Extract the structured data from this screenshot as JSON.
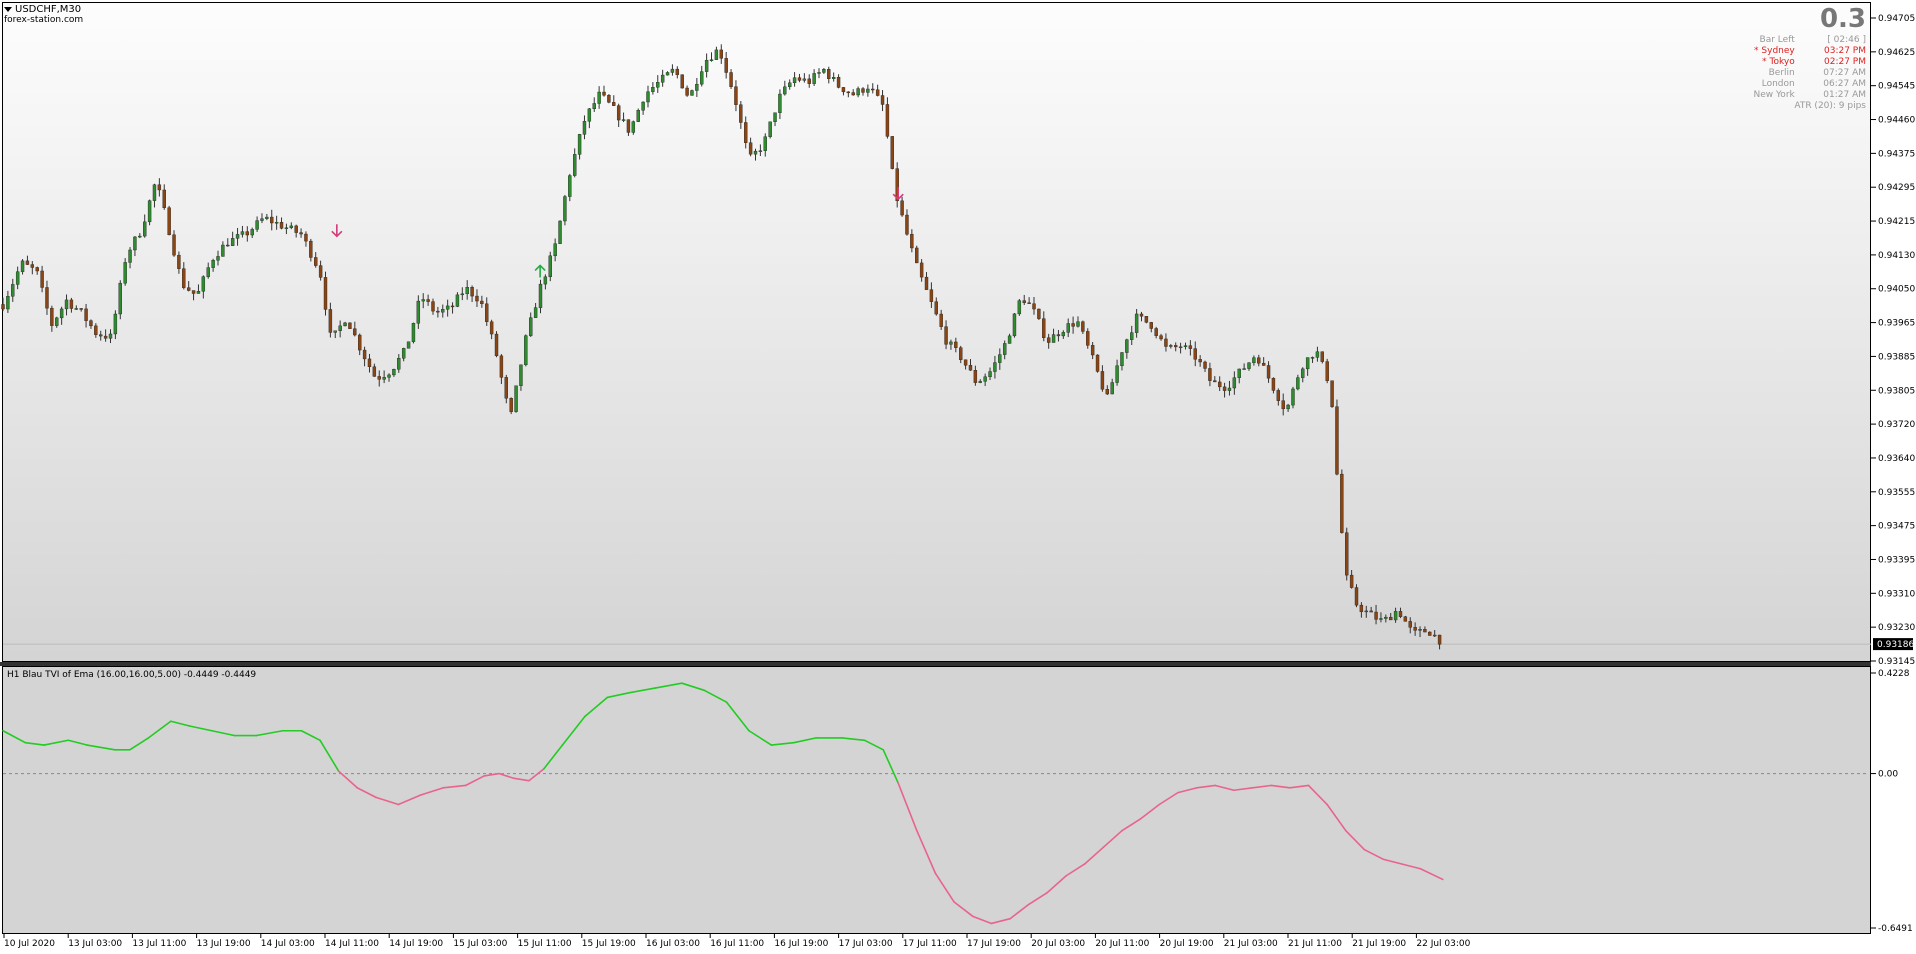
{
  "header": {
    "symbol": "USDCHF,M30",
    "site": "forex-station.com"
  },
  "info_panel": {
    "value": "0.3",
    "rows": [
      {
        "label": "Bar Left",
        "value": "[ 02:46 ]",
        "color": "#999999"
      },
      {
        "label": "* Sydney",
        "value": "03:27 PM",
        "color": "#e02020"
      },
      {
        "label": "* Tokyo",
        "value": "02:27 PM",
        "color": "#e02020"
      },
      {
        "label": "Berlin",
        "value": "07:27 AM",
        "color": "#999999"
      },
      {
        "label": "London",
        "value": "06:27 AM",
        "color": "#999999"
      },
      {
        "label": "New York",
        "value": "01:27 AM",
        "color": "#999999"
      }
    ],
    "atr": "ATR (20): 9 pips"
  },
  "price_axis": {
    "labels": [
      "0.94705",
      "0.94625",
      "0.94545",
      "0.94460",
      "0.94375",
      "0.94295",
      "0.94215",
      "0.94130",
      "0.94050",
      "0.93965",
      "0.93885",
      "0.93805",
      "0.93720",
      "0.93640",
      "0.93555",
      "0.93475",
      "0.93395",
      "0.93310",
      "0.93230",
      "0.93145"
    ],
    "current": "0.93186",
    "min": 0.93145,
    "max": 0.94705
  },
  "indicator": {
    "name": "H1 Blau TVI of Ema (16.00,16.00,5.00) -0.4449 -0.4449",
    "axis_labels": [
      "0.4228",
      "0.00",
      "-0.6491"
    ],
    "max": 0.4228,
    "min": -0.6491,
    "up_color": "#22cc22",
    "down_color": "#e8648c"
  },
  "time_axis": {
    "labels": [
      "10 Jul 2020",
      "13 Jul 03:00",
      "13 Jul 11:00",
      "13 Jul 19:00",
      "14 Jul 03:00",
      "14 Jul 11:00",
      "14 Jul 19:00",
      "15 Jul 03:00",
      "15 Jul 11:00",
      "15 Jul 19:00",
      "16 Jul 03:00",
      "16 Jul 11:00",
      "16 Jul 19:00",
      "17 Jul 03:00",
      "17 Jul 11:00",
      "17 Jul 19:00",
      "20 Jul 03:00",
      "20 Jul 11:00",
      "20 Jul 19:00",
      "21 Jul 03:00",
      "21 Jul 11:00",
      "21 Jul 19:00",
      "22 Jul 03:00"
    ]
  },
  "colors": {
    "bull_candle": "#2e8b2e",
    "bear_candle": "#8b4513",
    "arrow_down": "#d63a7a",
    "arrow_up": "#22aa44"
  },
  "chart_data": {
    "type": "candlestick",
    "close_path": [
      [
        0.0,
        0.9401
      ],
      [
        0.01,
        0.9411
      ],
      [
        0.018,
        0.9409
      ],
      [
        0.026,
        0.9396
      ],
      [
        0.034,
        0.9402
      ],
      [
        0.042,
        0.9399
      ],
      [
        0.05,
        0.9394
      ],
      [
        0.058,
        0.9393
      ],
      [
        0.066,
        0.9413
      ],
      [
        0.074,
        0.9419
      ],
      [
        0.082,
        0.9431
      ],
      [
        0.088,
        0.9421
      ],
      [
        0.096,
        0.9406
      ],
      [
        0.104,
        0.9403
      ],
      [
        0.112,
        0.9412
      ],
      [
        0.12,
        0.9416
      ],
      [
        0.13,
        0.9418
      ],
      [
        0.14,
        0.9422
      ],
      [
        0.15,
        0.942
      ],
      [
        0.16,
        0.9418
      ],
      [
        0.17,
        0.9409
      ],
      [
        0.176,
        0.9392
      ],
      [
        0.184,
        0.9398
      ],
      [
        0.192,
        0.939
      ],
      [
        0.2,
        0.9383
      ],
      [
        0.208,
        0.9385
      ],
      [
        0.216,
        0.939
      ],
      [
        0.224,
        0.9403
      ],
      [
        0.232,
        0.9399
      ],
      [
        0.24,
        0.94
      ],
      [
        0.248,
        0.9405
      ],
      [
        0.256,
        0.9402
      ],
      [
        0.264,
        0.939
      ],
      [
        0.272,
        0.9373
      ],
      [
        0.28,
        0.9392
      ],
      [
        0.288,
        0.9405
      ],
      [
        0.296,
        0.9415
      ],
      [
        0.304,
        0.9433
      ],
      [
        0.312,
        0.9446
      ],
      [
        0.32,
        0.9452
      ],
      [
        0.328,
        0.9448
      ],
      [
        0.336,
        0.9443
      ],
      [
        0.344,
        0.9452
      ],
      [
        0.352,
        0.9455
      ],
      [
        0.36,
        0.9458
      ],
      [
        0.368,
        0.9451
      ],
      [
        0.376,
        0.946
      ],
      [
        0.384,
        0.9463
      ],
      [
        0.392,
        0.9452
      ],
      [
        0.4,
        0.9436
      ],
      [
        0.408,
        0.944
      ],
      [
        0.416,
        0.9451
      ],
      [
        0.424,
        0.9456
      ],
      [
        0.432,
        0.9455
      ],
      [
        0.44,
        0.9458
      ],
      [
        0.448,
        0.9454
      ],
      [
        0.456,
        0.9452
      ],
      [
        0.464,
        0.9454
      ],
      [
        0.472,
        0.9449
      ],
      [
        0.478,
        0.9429
      ],
      [
        0.484,
        0.9419
      ],
      [
        0.49,
        0.941
      ],
      [
        0.498,
        0.9401
      ],
      [
        0.506,
        0.9392
      ],
      [
        0.514,
        0.9388
      ],
      [
        0.522,
        0.9382
      ],
      [
        0.53,
        0.9385
      ],
      [
        0.538,
        0.9392
      ],
      [
        0.546,
        0.9403
      ],
      [
        0.552,
        0.94
      ],
      [
        0.56,
        0.9392
      ],
      [
        0.568,
        0.9395
      ],
      [
        0.576,
        0.9397
      ],
      [
        0.584,
        0.9388
      ],
      [
        0.592,
        0.9378
      ],
      [
        0.6,
        0.939
      ],
      [
        0.608,
        0.9398
      ],
      [
        0.616,
        0.9396
      ],
      [
        0.624,
        0.939
      ],
      [
        0.632,
        0.9391
      ],
      [
        0.64,
        0.9388
      ],
      [
        0.648,
        0.9382
      ],
      [
        0.656,
        0.9381
      ],
      [
        0.664,
        0.9385
      ],
      [
        0.672,
        0.9389
      ],
      [
        0.68,
        0.9382
      ],
      [
        0.688,
        0.9375
      ],
      [
        0.696,
        0.9386
      ],
      [
        0.704,
        0.939
      ],
      [
        0.712,
        0.9381
      ],
      [
        0.716,
        0.9355
      ],
      [
        0.72,
        0.9335
      ],
      [
        0.726,
        0.9328
      ],
      [
        0.732,
        0.9326
      ],
      [
        0.74,
        0.9324
      ],
      [
        0.748,
        0.9327
      ],
      [
        0.756,
        0.9321
      ],
      [
        0.764,
        0.9322
      ],
      [
        0.772,
        0.9319
      ]
    ],
    "indicator_line": [
      [
        0.0,
        0.18
      ],
      [
        0.012,
        0.13
      ],
      [
        0.022,
        0.12
      ],
      [
        0.035,
        0.14
      ],
      [
        0.045,
        0.12
      ],
      [
        0.06,
        0.1
      ],
      [
        0.068,
        0.1
      ],
      [
        0.078,
        0.15
      ],
      [
        0.09,
        0.22
      ],
      [
        0.1,
        0.2
      ],
      [
        0.112,
        0.18
      ],
      [
        0.124,
        0.16
      ],
      [
        0.136,
        0.16
      ],
      [
        0.15,
        0.18
      ],
      [
        0.16,
        0.18
      ],
      [
        0.17,
        0.14
      ],
      [
        0.18,
        0.01
      ],
      [
        0.19,
        -0.06
      ],
      [
        0.2,
        -0.1
      ],
      [
        0.212,
        -0.13
      ],
      [
        0.224,
        -0.09
      ],
      [
        0.236,
        -0.06
      ],
      [
        0.248,
        -0.05
      ],
      [
        0.258,
        -0.01
      ],
      [
        0.266,
        0.0
      ],
      [
        0.274,
        -0.02
      ],
      [
        0.282,
        -0.03
      ],
      [
        0.29,
        0.02
      ],
      [
        0.3,
        0.12
      ],
      [
        0.312,
        0.24
      ],
      [
        0.324,
        0.32
      ],
      [
        0.336,
        0.34
      ],
      [
        0.35,
        0.36
      ],
      [
        0.364,
        0.38
      ],
      [
        0.376,
        0.35
      ],
      [
        0.388,
        0.3
      ],
      [
        0.4,
        0.18
      ],
      [
        0.412,
        0.12
      ],
      [
        0.424,
        0.13
      ],
      [
        0.436,
        0.15
      ],
      [
        0.45,
        0.15
      ],
      [
        0.462,
        0.14
      ],
      [
        0.472,
        0.1
      ],
      [
        0.48,
        -0.04
      ],
      [
        0.49,
        -0.24
      ],
      [
        0.5,
        -0.42
      ],
      [
        0.51,
        -0.54
      ],
      [
        0.52,
        -0.6
      ],
      [
        0.53,
        -0.63
      ],
      [
        0.54,
        -0.61
      ],
      [
        0.55,
        -0.55
      ],
      [
        0.56,
        -0.5
      ],
      [
        0.57,
        -0.43
      ],
      [
        0.58,
        -0.38
      ],
      [
        0.59,
        -0.31
      ],
      [
        0.6,
        -0.24
      ],
      [
        0.61,
        -0.19
      ],
      [
        0.62,
        -0.13
      ],
      [
        0.63,
        -0.08
      ],
      [
        0.64,
        -0.06
      ],
      [
        0.65,
        -0.05
      ],
      [
        0.66,
        -0.07
      ],
      [
        0.67,
        -0.06
      ],
      [
        0.68,
        -0.05
      ],
      [
        0.69,
        -0.06
      ],
      [
        0.7,
        -0.05
      ],
      [
        0.71,
        -0.13
      ],
      [
        0.72,
        -0.24
      ],
      [
        0.73,
        -0.32
      ],
      [
        0.74,
        -0.36
      ],
      [
        0.75,
        -0.38
      ],
      [
        0.76,
        -0.4
      ],
      [
        0.772,
        -0.4449
      ]
    ],
    "arrows": [
      {
        "t": 0.179,
        "price": 0.9419,
        "dir": "down"
      },
      {
        "t": 0.288,
        "price": 0.9409,
        "dir": "up"
      },
      {
        "t": 0.48,
        "price": 0.9428,
        "dir": "down"
      }
    ]
  }
}
